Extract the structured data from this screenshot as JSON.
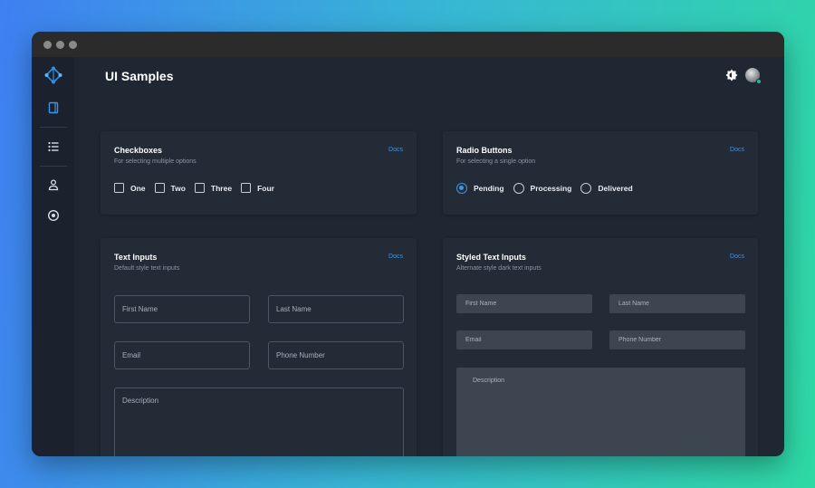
{
  "header": {
    "title": "UI Samples"
  },
  "sidebar": {
    "items": [
      {
        "icon": "logo-icon"
      },
      {
        "icon": "tablet-icon"
      },
      {
        "icon": "list-icon"
      },
      {
        "icon": "user-icon"
      },
      {
        "icon": "target-icon"
      }
    ]
  },
  "topbar": {
    "theme_icon": "sun-gear-icon",
    "avatar_status_color": "#2ab39b"
  },
  "colors": {
    "accent": "#3d96e6",
    "background": "#1f2733",
    "card": "#232b37"
  },
  "checkboxes": {
    "title": "Checkboxes",
    "subtitle": "For selecting multiple options",
    "docs": "Docs",
    "options": [
      {
        "label": "One",
        "checked": false
      },
      {
        "label": "Two",
        "checked": false
      },
      {
        "label": "Three",
        "checked": false
      },
      {
        "label": "Four",
        "checked": false
      }
    ]
  },
  "radios": {
    "title": "Radio Buttons",
    "subtitle": "For selecting a single option",
    "docs": "Docs",
    "selected": "Pending",
    "options": [
      {
        "label": "Pending"
      },
      {
        "label": "Processing"
      },
      {
        "label": "Delivered"
      }
    ]
  },
  "text_inputs": {
    "title": "Text Inputs",
    "subtitle": "Default style text inputs",
    "docs": "Docs",
    "first_name": "First Name",
    "last_name": "Last Name",
    "email": "Email",
    "phone": "Phone Number",
    "description": "Description"
  },
  "styled_inputs": {
    "title": "Styled Text Inputs",
    "subtitle": "Alternate style dark text inputs",
    "docs": "Docs",
    "first_name": "First Name",
    "last_name": "Last Name",
    "email": "Email",
    "phone": "Phone Number",
    "description": "Description"
  }
}
